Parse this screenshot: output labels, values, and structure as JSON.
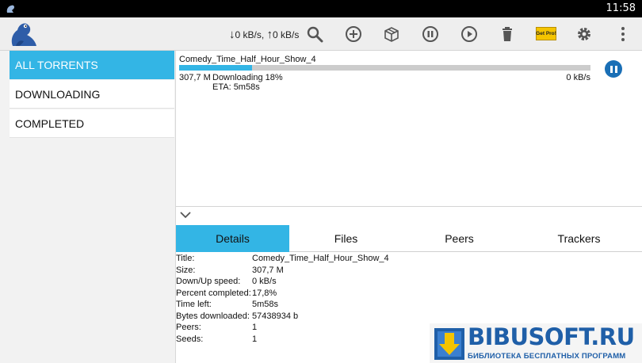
{
  "status_bar": {
    "time": "11:58"
  },
  "action_bar": {
    "speed_down": "0 kB/s,",
    "speed_up": "0 kB/s",
    "get_pro_label": "Get Pro!"
  },
  "sidebar": {
    "items": [
      {
        "label": "ALL TORRENTS",
        "active": true
      },
      {
        "label": "DOWNLOADING",
        "active": false
      },
      {
        "label": "COMPLETED",
        "active": false
      }
    ]
  },
  "torrents": [
    {
      "name": "Comedy_Time_Half_Hour_Show_4",
      "size": "307,7 M",
      "status": "Downloading 18%",
      "eta": "ETA: 5m58s",
      "speed": "0 kB/s",
      "progress": 0.178
    }
  ],
  "tabs": [
    {
      "label": "Details",
      "active": true
    },
    {
      "label": "Files",
      "active": false
    },
    {
      "label": "Peers",
      "active": false
    },
    {
      "label": "Trackers",
      "active": false
    }
  ],
  "details": [
    {
      "label": "Title:",
      "value": "Comedy_Time_Half_Hour_Show_4"
    },
    {
      "label": "Size:",
      "value": "307,7 M"
    },
    {
      "label": "Down/Up speed:",
      "value": "0 kB/s"
    },
    {
      "label": "Percent completed:",
      "value": "17,8%"
    },
    {
      "label": "Time left:",
      "value": "5m58s"
    },
    {
      "label": "Bytes downloaded:",
      "value": "57438934 b"
    },
    {
      "label": "Peers:",
      "value": "1"
    },
    {
      "label": "Seeds:",
      "value": "1"
    }
  ],
  "watermark": {
    "title": "BIBUSOFT.RU",
    "subtitle": "БИБЛИОТЕКА БЕСПЛАТНЫХ ПРОГРАММ"
  },
  "colors": {
    "accent": "#33b5e5",
    "pause_button": "#1a6fb6",
    "watermark_blue": "#1f5fa8"
  },
  "icons": [
    "frog-logo-icon",
    "search-icon",
    "add-icon",
    "box-icon",
    "pause-all-icon",
    "resume-all-icon",
    "trash-icon",
    "gear-icon",
    "overflow-menu-icon",
    "chevron-down-icon",
    "pause-icon"
  ]
}
